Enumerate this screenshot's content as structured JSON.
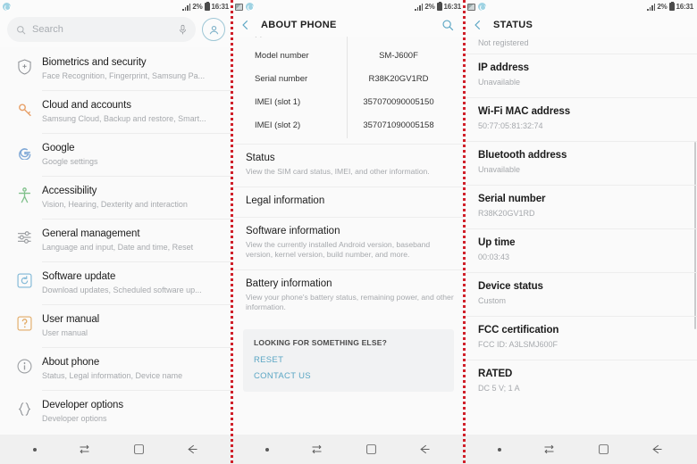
{
  "statusbar": {
    "battery": "2%",
    "time": "16:31",
    "icons": [
      "photo-icon",
      "sync-icon",
      "signal-icon",
      "battery-icon"
    ]
  },
  "panel1": {
    "search": {
      "placeholder": "Search",
      "mic_icon": "microphone-icon",
      "search_icon": "search-icon"
    },
    "avatar_icon": "account-avatar-icon",
    "items": [
      {
        "icon": "shield-plus-icon",
        "color": "#8e9196",
        "title": "Biometrics and security",
        "subtitle": "Face Recognition, Fingerprint, Samsung Pa..."
      },
      {
        "icon": "key-icon",
        "color": "#e8a16a",
        "title": "Cloud and accounts",
        "subtitle": "Samsung Cloud, Backup and restore, Smart..."
      },
      {
        "icon": "google-g-icon",
        "color": "#7fa8d6",
        "title": "Google",
        "subtitle": "Google settings"
      },
      {
        "icon": "accessibility-person-icon",
        "color": "#7fc08a",
        "title": "Accessibility",
        "subtitle": "Vision, Hearing, Dexterity and interaction"
      },
      {
        "icon": "sliders-icon",
        "color": "#9a9da1",
        "title": "General management",
        "subtitle": "Language and input, Date and time, Reset"
      },
      {
        "icon": "software-update-icon",
        "color": "#7fb7d6",
        "title": "Software update",
        "subtitle": "Download updates, Scheduled software up..."
      },
      {
        "icon": "user-manual-icon",
        "color": "#e2ab66",
        "title": "User manual",
        "subtitle": "User manual"
      },
      {
        "icon": "info-circle-icon",
        "color": "#9a9da1",
        "title": "About phone",
        "subtitle": "Status, Legal information, Device name"
      },
      {
        "icon": "braces-icon",
        "color": "#8e9196",
        "title": "Developer options",
        "subtitle": "Developer options"
      }
    ]
  },
  "panel2": {
    "back_icon": "back-chevron-icon",
    "title": "ABOUT PHONE",
    "search_icon": "search-icon",
    "info_table": [
      {
        "key": "Model number",
        "value": "SM-J600F"
      },
      {
        "key": "Serial number",
        "value": "R38K20GV1RD"
      },
      {
        "key": "IMEI (slot 1)",
        "value": "357070090005150"
      },
      {
        "key": "IMEI (slot 2)",
        "value": "357071090005158"
      }
    ],
    "menu": [
      {
        "title": "Status",
        "subtitle": "View the SIM card status, IMEI, and other information."
      },
      {
        "title": "Legal information",
        "subtitle": ""
      },
      {
        "title": "Software information",
        "subtitle": "View the currently installed Android version, baseband version, kernel version, build number, and more."
      },
      {
        "title": "Battery information",
        "subtitle": "View your phone's battery status, remaining power, and other information."
      }
    ],
    "looking_card": {
      "heading": "LOOKING FOR SOMETHING ELSE?",
      "links": [
        "RESET",
        "CONTACT US"
      ],
      "link_color": "#5ba6c4"
    }
  },
  "panel3": {
    "back_icon": "back-chevron-icon",
    "title": "STATUS",
    "truncated_top": "Not registered",
    "rows": [
      {
        "key": "IP address",
        "value": "Unavailable"
      },
      {
        "key": "Wi-Fi MAC address",
        "value": "50:77:05:81:32:74"
      },
      {
        "key": "Bluetooth address",
        "value": "Unavailable"
      },
      {
        "key": "Serial number",
        "value": "R38K20GV1RD"
      },
      {
        "key": "Up time",
        "value": "00:03:43"
      },
      {
        "key": "Device status",
        "value": "Custom"
      },
      {
        "key": "FCC certification",
        "value": "FCC ID: A3LSMJ600F"
      },
      {
        "key": "RATED",
        "value": "DC 5 V; 1 A"
      }
    ]
  },
  "navbar": {
    "items": [
      "nav-dot",
      "recents-icon",
      "home-icon",
      "back-icon"
    ]
  }
}
